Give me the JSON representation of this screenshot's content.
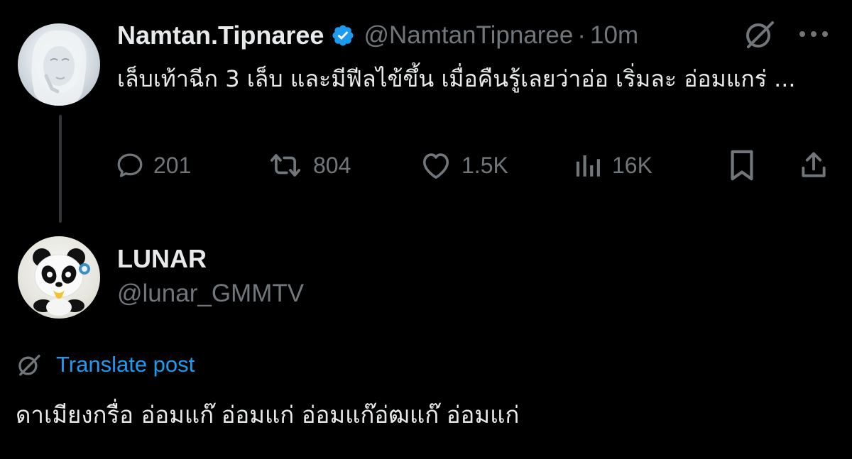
{
  "tweet": {
    "author": {
      "display_name": "Namtan.Tipnaree",
      "handle": "@NamtanTipnaree",
      "verified_icon": "verified-badge-icon",
      "avatar_icon": "profile-photo"
    },
    "separator": "·",
    "time": "10m",
    "text": "เล็บเท้าฉีก 3 เล็บ และมีฟีลไข้ขึ้น เมื่อคืนรู้เลยว่าอ่อ เริ่มละ อ่อมแกร่ ...",
    "actions": {
      "replies": "201",
      "reposts": "804",
      "likes": "1.5K",
      "views": "16K"
    }
  },
  "reply": {
    "author": {
      "display_name": "LUNAR",
      "handle": "@lunar_GMMTV",
      "avatar_icon": "panda-avatar"
    },
    "translate_label": "Translate post",
    "text": "ดาเมียงกรื่อ อ่อมแก๊ อ่อมแก่ อ่อมแก๊อ่ฒแก๊ อ่อมแก่"
  },
  "colors": {
    "background": "#000000",
    "text": "#e7e9ea",
    "secondary": "#71767b",
    "accent": "#1d9bf0",
    "thread_line": "#333639"
  }
}
